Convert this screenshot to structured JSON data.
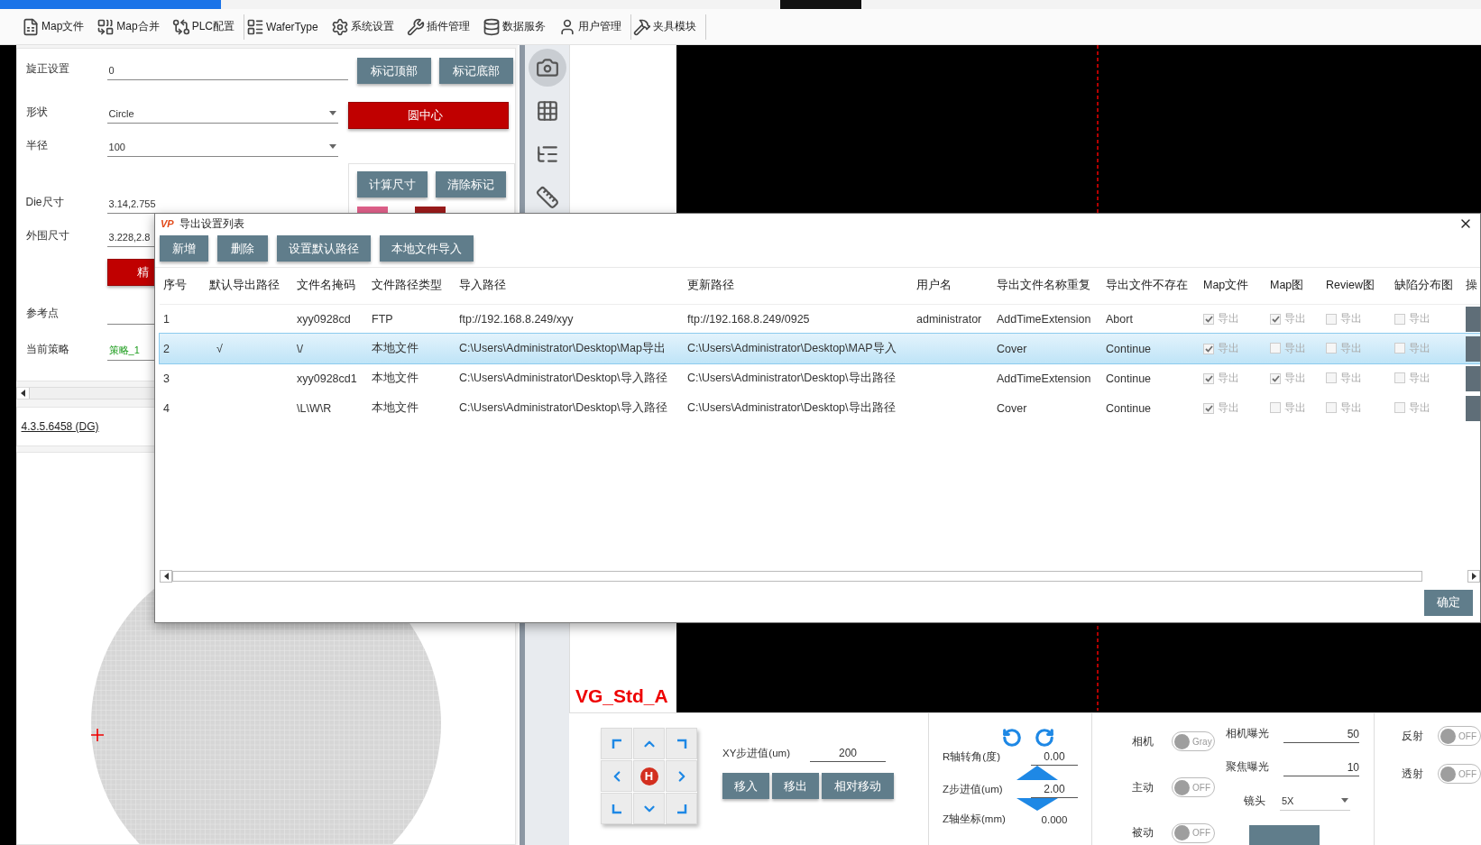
{
  "toolbar": {
    "groups": [
      {
        "items": [
          {
            "label": "Map文件"
          },
          {
            "label": "Map合并"
          },
          {
            "label": "PLC配置"
          }
        ]
      },
      {
        "items": [
          {
            "label": "WaferType"
          },
          {
            "label": "系统设置"
          },
          {
            "label": "插件管理"
          },
          {
            "label": "数据服务"
          },
          {
            "label": "用户管理"
          }
        ]
      },
      {
        "items": [
          {
            "label": "夹具模块"
          }
        ]
      }
    ]
  },
  "left_panel": {
    "form": [
      {
        "kind": "input",
        "label": "旋正设置",
        "value": "0"
      },
      {
        "kind": "select",
        "label": "形状",
        "value": "Circle"
      },
      {
        "kind": "select",
        "label": "半径",
        "value": "100"
      },
      {
        "kind": "input",
        "label": "Die尺寸",
        "value": "3.14,2.755"
      },
      {
        "kind": "input",
        "label": "外围尺寸",
        "value": "3.228,2.8"
      },
      {
        "kind": "button",
        "value": "精"
      },
      {
        "kind": "input",
        "label": "参考点"
      },
      {
        "kind": "strategy",
        "label": "当前策略",
        "value": "策略_1"
      }
    ],
    "mark_buttons": [
      "标记顶部",
      "标记底部"
    ],
    "center_button": "圆中心",
    "measure_buttons": [
      "计算尺寸",
      "清除标记"
    ],
    "version": "4.3.5.6458 (DG)"
  },
  "side_tools": [
    {
      "selected": true
    },
    {
      "selected": false
    },
    {
      "selected": false
    },
    {
      "selected": false
    }
  ],
  "camera": {
    "label": "VG_Std_A"
  },
  "motion": {
    "home_label": "H",
    "xy_step": {
      "label": "XY步进值(um)",
      "value": "200"
    },
    "buttons": [
      "移入",
      "移出",
      "相对移动"
    ],
    "r_angle": {
      "label": "R轴转角(度)",
      "value": "0.00"
    },
    "z_step": {
      "label": "Z步进值(um)",
      "value": "2.00"
    },
    "z_pos": {
      "label": "Z轴坐标(mm)",
      "value": "0.000"
    }
  },
  "optics": {
    "toggles": [
      {
        "label": "相机",
        "text": "Gray",
        "on": false
      },
      {
        "label": "主动",
        "text": "OFF",
        "on": false
      },
      {
        "label": "被动",
        "text": "OFF",
        "on": false
      }
    ],
    "exposure": [
      {
        "label": "相机曝光",
        "value": "50"
      },
      {
        "label": "聚焦曝光",
        "value": "10"
      }
    ],
    "lens": {
      "label": "镜头",
      "value": "5X"
    },
    "light_toggles": [
      {
        "label": "反射",
        "text": "OFF",
        "on": false
      },
      {
        "label": "透射",
        "text": "OFF",
        "on": false
      }
    ]
  },
  "dialog": {
    "logo": "VP",
    "title": "导出设置列表",
    "buttons": [
      "新增",
      "删除",
      "设置默认路径",
      "本地文件导入"
    ],
    "columns": [
      "序号",
      "默认导出路径",
      "文件名掩码",
      "文件路径类型",
      "导入路径",
      "更新路径",
      "用户名",
      "导出文件名称重复",
      "导出文件不存在",
      "Map文件",
      "Map图",
      "Review图",
      "缺陷分布图",
      "操"
    ],
    "rows": [
      {
        "selected": false,
        "no": "1",
        "mask": "xyy0928cd",
        "path_type": "FTP",
        "import_path": "ftp://192.168.8.249/xyy",
        "update_path": "ftp://192.168.8.249/0925",
        "user": "administrator",
        "on_duplicate": "AddTimeExtension",
        "on_missing": "Abort",
        "exports": [
          {
            "label": "导出",
            "checked": true,
            "disabled": true
          },
          {
            "label": "导出",
            "checked": true,
            "disabled": true
          },
          {
            "label": "导出",
            "checked": false,
            "disabled": true
          },
          {
            "label": "导出",
            "checked": false,
            "disabled": true
          }
        ]
      },
      {
        "selected": true,
        "no": "2",
        "default_mark": "√",
        "mask": "\\/",
        "path_type": "本地文件",
        "import_path": "C:\\Users\\Administrator\\Desktop\\Map导出",
        "update_path": "C:\\Users\\Administrator\\Desktop\\MAP导入",
        "on_duplicate": "Cover",
        "on_missing": "Continue",
        "exports": [
          {
            "label": "导出",
            "checked": true,
            "disabled": true
          },
          {
            "label": "导出",
            "checked": false,
            "disabled": true
          },
          {
            "label": "导出",
            "checked": false,
            "disabled": true
          },
          {
            "label": "导出",
            "checked": false,
            "disabled": true
          }
        ]
      },
      {
        "selected": false,
        "no": "3",
        "mask": "xyy0928cd1",
        "path_type": "本地文件",
        "import_path": "C:\\Users\\Administrator\\Desktop\\导入路径",
        "update_path": "C:\\Users\\Administrator\\Desktop\\导出路径",
        "on_duplicate": "AddTimeExtension",
        "on_missing": "Continue",
        "exports": [
          {
            "label": "导出",
            "checked": true,
            "disabled": true
          },
          {
            "label": "导出",
            "checked": true,
            "disabled": true
          },
          {
            "label": "导出",
            "checked": false,
            "disabled": true
          },
          {
            "label": "导出",
            "checked": false,
            "disabled": true
          }
        ]
      },
      {
        "selected": false,
        "no": "4",
        "mask": "\\L\\W\\R",
        "path_type": "本地文件",
        "import_path": "C:\\Users\\Administrator\\Desktop\\导入路径",
        "update_path": "C:\\Users\\Administrator\\Desktop\\导出路径",
        "on_duplicate": "Cover",
        "on_missing": "Continue",
        "exports": [
          {
            "label": "导出",
            "checked": true,
            "disabled": true
          },
          {
            "label": "导出",
            "checked": false,
            "disabled": true
          },
          {
            "label": "导出",
            "checked": false,
            "disabled": true
          },
          {
            "label": "导出",
            "checked": false,
            "disabled": true
          }
        ]
      }
    ],
    "ok_button": "确定"
  }
}
